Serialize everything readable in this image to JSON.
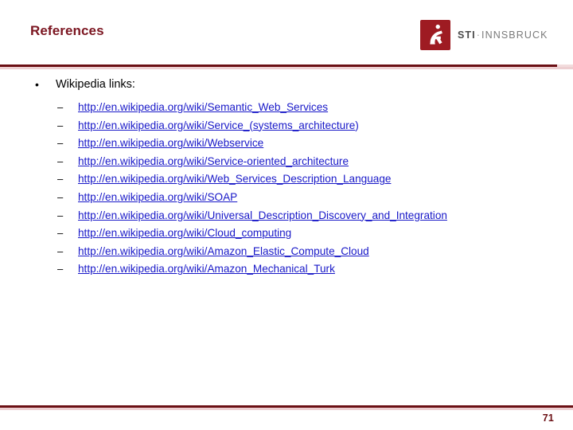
{
  "slide": {
    "title": "References",
    "page_number": "71",
    "accent_dark": "#6b0f14",
    "accent_light": "#edcfd1",
    "title_color": "#7b1520",
    "link_color": "#1818c8",
    "logo_color": "#9e1b22"
  },
  "logo": {
    "mark_name": "sti-figure-icon",
    "text_primary": "STI",
    "separator": "·",
    "text_secondary": "INNSBRUCK"
  },
  "body": {
    "heading": {
      "marker": "•",
      "label": "Wikipedia links:"
    },
    "item_marker": "–",
    "links": [
      {
        "text": "http://en.wikipedia.org/wiki/Semantic_Web_Services",
        "tail": ""
      },
      {
        "text": "http://en.wikipedia.org/wiki/Service_(systems_architecture",
        "tail": ")"
      },
      {
        "text": "http://en.wikipedia.org/wiki/Webservice",
        "tail": ""
      },
      {
        "text": "http://en.wikipedia.org/wiki/Service-oriented_architecture",
        "tail": ""
      },
      {
        "text": "http://en.wikipedia.org/wiki/Web_Services_Description_Language",
        "tail": ""
      },
      {
        "text": "http://en.wikipedia.org/wiki/SOAP",
        "tail": ""
      },
      {
        "text": "http://en.wikipedia.org/wiki/Universal_Description_Discovery_and_Integration",
        "tail": ""
      },
      {
        "text": "http://en.wikipedia.org/wiki/Cloud_computing",
        "tail": ""
      },
      {
        "text": "http://en.wikipedia.org/wiki/Amazon_Elastic_Compute_Cloud",
        "tail": ""
      },
      {
        "text": "http://en.wikipedia.org/wiki/Amazon_Mechanical_Turk",
        "tail": ""
      }
    ]
  }
}
